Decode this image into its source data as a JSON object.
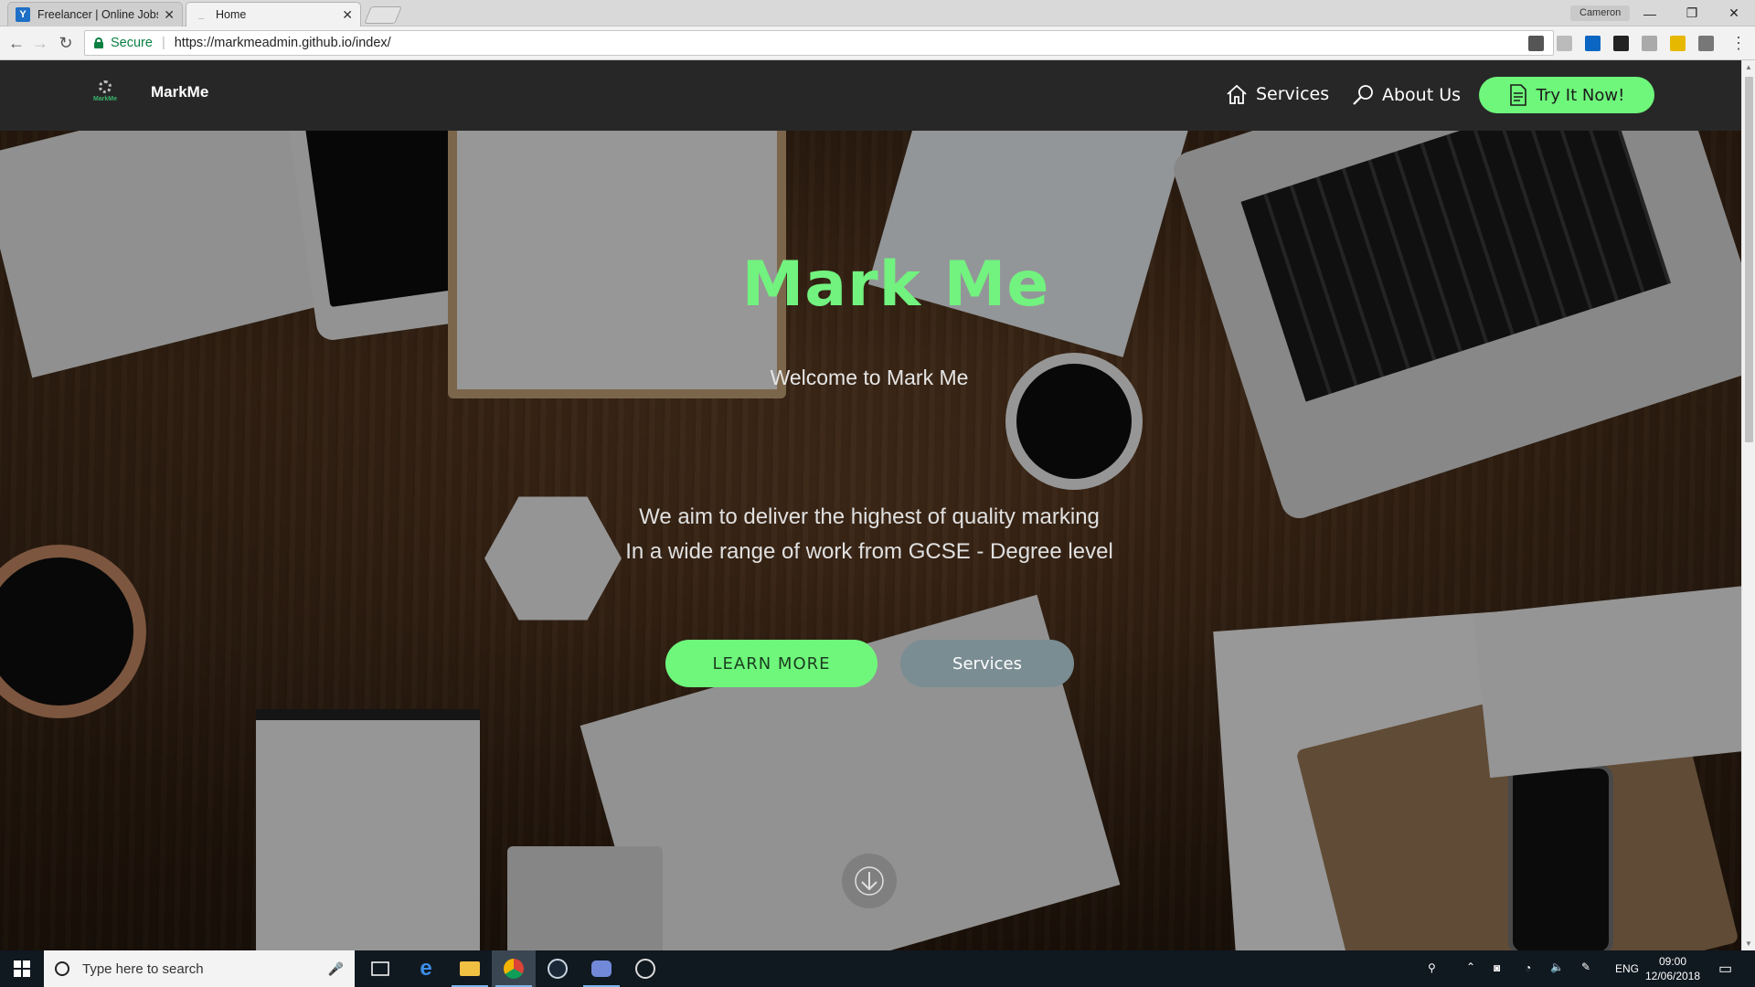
{
  "browser": {
    "tabs": [
      {
        "title": "Freelancer | Online Jobs |",
        "active": false,
        "favicon": "freelancer-icon"
      },
      {
        "title": "Home",
        "active": true,
        "favicon": "page-icon"
      }
    ],
    "profile_name": "Cameron",
    "secure_label": "Secure",
    "url": "https://markmeadmin.github.io/index/"
  },
  "site": {
    "brand": "MarkMe",
    "logo_caption": "MarkMe",
    "nav": {
      "services": "Services",
      "about": "About Us",
      "try": "Try It Now!"
    },
    "hero": {
      "title": "Mark Me",
      "subtitle": "Welcome to Mark Me",
      "line1": "We aim to deliver the highest of quality marking",
      "line2": "In a wide range of work from GCSE - Degree level",
      "learn_more": "LEARN MORE",
      "services_button": "Services"
    },
    "colors": {
      "accent": "#6ef77b",
      "navbar": "#272727",
      "secondary_button": "#7a8d93"
    }
  },
  "taskbar": {
    "search_placeholder": "Type here to search",
    "language": "ENG",
    "time": "09:00",
    "date": "12/06/2018"
  }
}
